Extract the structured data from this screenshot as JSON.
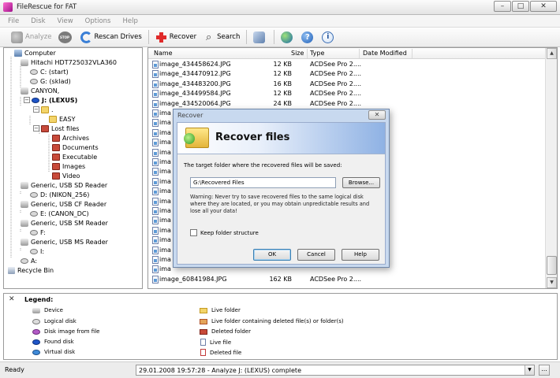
{
  "window": {
    "title": "FileRescue for FAT",
    "minimize": "–",
    "maximize": "□",
    "close": "✕"
  },
  "menu": [
    "File",
    "Disk",
    "View",
    "Options",
    "Help"
  ],
  "toolbar": {
    "analyze": "Analyze",
    "stop": "STOP",
    "rescan": "Rescan Drives",
    "recover": "Recover",
    "search": "Search",
    "help_glyph": "?",
    "info_glyph": "i",
    "icons": [
      "analyze-icon",
      "stop-icon",
      "rescan-icon",
      "recover-icon",
      "search-icon",
      "wizard-icon",
      "globe-icon",
      "help-icon",
      "info-icon"
    ]
  },
  "tree": [
    {
      "label": "Computer",
      "icon": "computer"
    },
    {
      "label": "Hitachi HDT725032VLA360",
      "icon": "device"
    },
    {
      "label": "C: (start)",
      "icon": "disk"
    },
    {
      "label": "G: (sklad)",
      "icon": "disk"
    },
    {
      "label": "CANYON,",
      "icon": "device"
    },
    {
      "label": "J: (LEXUS)",
      "icon": "found",
      "bold": true
    },
    {
      "label": ".",
      "icon": "folder"
    },
    {
      "label": "EASY",
      "icon": "folder"
    },
    {
      "label": "Lost files",
      "icon": "delfolder"
    },
    {
      "label": "Archives",
      "icon": "delfolder"
    },
    {
      "label": "Documents",
      "icon": "delfolder"
    },
    {
      "label": "Executable",
      "icon": "delfolder"
    },
    {
      "label": "Images",
      "icon": "delfolder"
    },
    {
      "label": "Video",
      "icon": "delfolder"
    },
    {
      "label": "Generic, USB SD Reader",
      "icon": "device"
    },
    {
      "label": "D: (NIKON_256)",
      "icon": "disk"
    },
    {
      "label": "Generic, USB CF Reader",
      "icon": "device"
    },
    {
      "label": "E: (CANON_DC)",
      "icon": "disk"
    },
    {
      "label": "Generic, USB SM Reader",
      "icon": "device"
    },
    {
      "label": "F:",
      "icon": "disk"
    },
    {
      "label": "Generic, USB MS Reader",
      "icon": "device"
    },
    {
      "label": "I:",
      "icon": "disk"
    },
    {
      "label": "A:",
      "icon": "disk"
    },
    {
      "label": "Recycle Bin",
      "icon": "recycle"
    }
  ],
  "filelist": {
    "columns": {
      "name": "Name",
      "size": "Size",
      "type": "Type",
      "date": "Date Modified"
    },
    "rows": [
      {
        "name": "image_434458624.JPG",
        "size": "12 KB",
        "type": "ACDSee Pro 2...."
      },
      {
        "name": "image_434470912.JPG",
        "size": "12 KB",
        "type": "ACDSee Pro 2...."
      },
      {
        "name": "image_434483200.JPG",
        "size": "16 KB",
        "type": "ACDSee Pro 2...."
      },
      {
        "name": "image_434499584.JPG",
        "size": "12 KB",
        "type": "ACDSee Pro 2...."
      },
      {
        "name": "image_434520064.JPG",
        "size": "24 KB",
        "type": "ACDSee Pro 2...."
      },
      {
        "name": "ima",
        "size": "",
        "type": ""
      },
      {
        "name": "ima",
        "size": "",
        "type": ""
      },
      {
        "name": "ima",
        "size": "",
        "type": ""
      },
      {
        "name": "ima",
        "size": "",
        "type": ""
      },
      {
        "name": "ima",
        "size": "",
        "type": ""
      },
      {
        "name": "ima",
        "size": "",
        "type": ""
      },
      {
        "name": "ima",
        "size": "",
        "type": ""
      },
      {
        "name": "ima",
        "size": "",
        "type": ""
      },
      {
        "name": "ima",
        "size": "",
        "type": ""
      },
      {
        "name": "ima",
        "size": "",
        "type": ""
      },
      {
        "name": "ima",
        "size": "",
        "type": ""
      },
      {
        "name": "ima",
        "size": "",
        "type": ""
      },
      {
        "name": "ima",
        "size": "",
        "type": ""
      },
      {
        "name": "ima",
        "size": "",
        "type": ""
      },
      {
        "name": "ima",
        "size": "",
        "type": ""
      },
      {
        "name": "ima",
        "size": "",
        "type": ""
      },
      {
        "name": "ima",
        "size": "",
        "type": ""
      },
      {
        "name": "image_60841984.JPG",
        "size": "162 KB",
        "type": "ACDSee Pro 2...."
      }
    ]
  },
  "legend": {
    "close": "✕",
    "title": "Legend:",
    "items": [
      {
        "label": "Device",
        "icon": "device"
      },
      {
        "label": "Logical disk",
        "icon": "logical"
      },
      {
        "label": "Disk image from file",
        "icon": "image"
      },
      {
        "label": "Found disk",
        "icon": "found"
      },
      {
        "label": "Virtual disk",
        "icon": "virtual"
      },
      {
        "label": "Live folder",
        "icon": "livefolder"
      },
      {
        "label": "Live folder containing deleted file(s) or folder(s)",
        "icon": "livefolderdel"
      },
      {
        "label": "Deleted folder",
        "icon": "delfolder"
      },
      {
        "label": "Live file",
        "icon": "livefile"
      },
      {
        "label": "Deleted file",
        "icon": "delfile"
      }
    ]
  },
  "status": {
    "ready": "Ready",
    "log": "29.01.2008 19:57:28 - Analyze J: (LEXUS) complete",
    "dots": "..."
  },
  "dialog": {
    "title": "Recover",
    "close": "✕",
    "heading": "Recover files",
    "target_label": "The target folder where the recovered files will be saved:",
    "path": "G:\\Recovered Files",
    "browse": "Browse...",
    "warning": "Warning: Never try to save recovered files to the same logical disk where they are located, or you may obtain unpredictable results and lose all your data!",
    "keep_structure": "Keep folder structure",
    "ok": "OK",
    "cancel": "Cancel",
    "help": "Help"
  }
}
